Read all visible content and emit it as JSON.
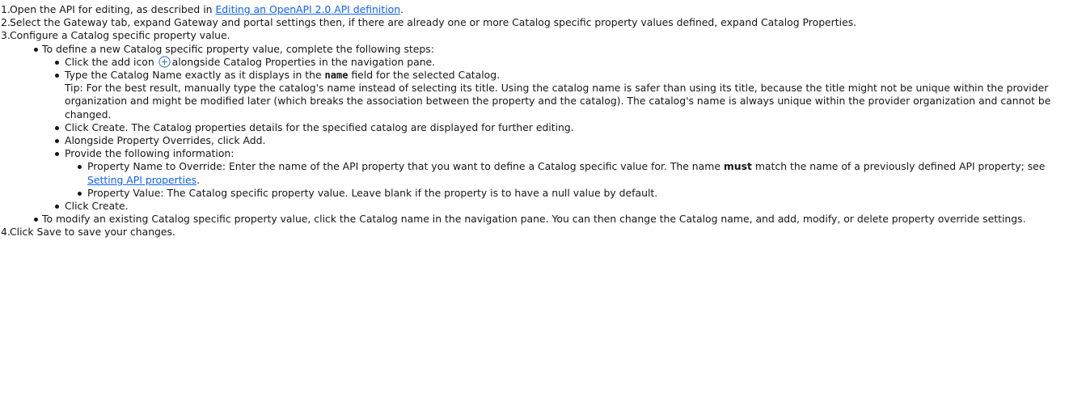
{
  "steps": [
    {
      "num": "1.",
      "text_before": "Open the API for editing, as described in ",
      "link": "Editing an OpenAPI 2.0 API definition",
      "text_after": "."
    },
    {
      "num": "2.",
      "text": "Select the Gateway tab, expand Gateway and portal settings then, if there are already one or more Catalog specific property values defined, expand Catalog Properties."
    },
    {
      "num": "3.",
      "text": "Configure a Catalog specific property value.",
      "define": {
        "intro": "To define a new Catalog specific property value, complete the following steps:",
        "click_add_before": "Click the add icon",
        "click_add_after": "alongside Catalog Properties in the navigation pane.",
        "type_name_before": "Type the Catalog Name exactly as it displays in the ",
        "type_name_code": "name",
        "type_name_after": " field for the selected Catalog.",
        "tip": "Tip: For the best result, manually type the catalog's name instead of selecting its title. Using the catalog name is safer than using its title, because the title might not be unique within the provider organization and might be modified later (which breaks the association between the property and the catalog). The catalog's name is always unique within the provider organization and cannot be changed.",
        "click_create": "Click Create. The Catalog properties details for the specified catalog are displayed for further editing.",
        "alongside": "Alongside Property Overrides, click Add.",
        "provide": "Provide the following information:",
        "prop_name_before": "Property Name to Override: Enter the name of the API property that you want to define a Catalog specific value for. The name ",
        "prop_name_bold": "must",
        "prop_name_middle": " match the name of a previously defined API property; see ",
        "prop_name_link": "Setting API properties",
        "prop_name_after": ".",
        "prop_value": "Property Value: The Catalog specific property value. Leave blank if the property is to have a null value by default.",
        "click_create_final": "Click Create."
      },
      "modify": "To modify an existing Catalog specific property value, click the Catalog name in the navigation pane. You can then change the Catalog name, and add, modify, or delete property override settings."
    },
    {
      "num": "4.",
      "text": "Click Save to save your changes."
    }
  ],
  "colors": {
    "text": "#161616",
    "link": "#0f62fe",
    "add_icon": "#4178be"
  },
  "icons": {
    "add": "add-circle-icon"
  }
}
